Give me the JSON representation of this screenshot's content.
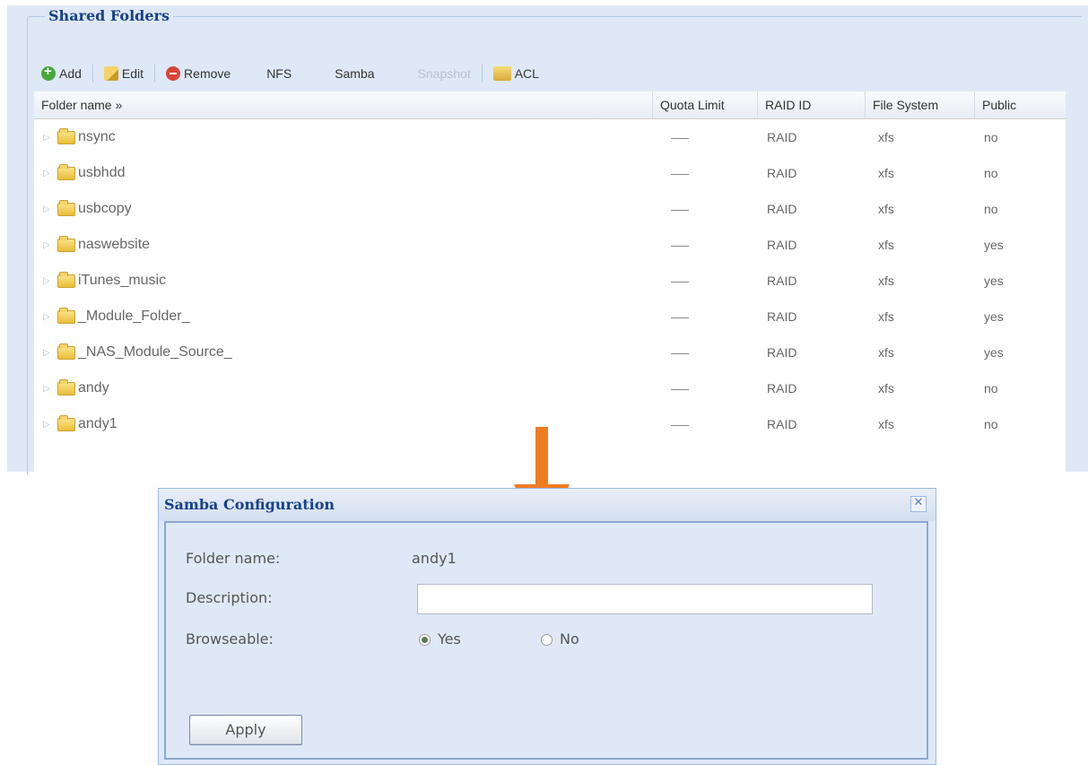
{
  "panel": {
    "title": "Shared Folders"
  },
  "toolbar": {
    "add": "Add",
    "edit": "Edit",
    "remove": "Remove",
    "nfs": "NFS",
    "samba": "Samba",
    "snapshot": "Snapshot",
    "acl": "ACL"
  },
  "grid": {
    "headers": {
      "name": "Folder name »",
      "quota": "Quota Limit",
      "raid": "RAID ID",
      "fs": "File System",
      "public": "Public"
    },
    "rows": [
      {
        "name": "nsync",
        "raid": "RAID",
        "fs": "xfs",
        "public": "no"
      },
      {
        "name": "usbhdd",
        "raid": "RAID",
        "fs": "xfs",
        "public": "no"
      },
      {
        "name": "usbcopy",
        "raid": "RAID",
        "fs": "xfs",
        "public": "no"
      },
      {
        "name": "naswebsite",
        "raid": "RAID",
        "fs": "xfs",
        "public": "yes"
      },
      {
        "name": "iTunes_music",
        "raid": "RAID",
        "fs": "xfs",
        "public": "yes"
      },
      {
        "name": "_Module_Folder_",
        "raid": "RAID",
        "fs": "xfs",
        "public": "yes"
      },
      {
        "name": "_NAS_Module_Source_",
        "raid": "RAID",
        "fs": "xfs",
        "public": "yes"
      },
      {
        "name": "andy",
        "raid": "RAID",
        "fs": "xfs",
        "public": "no"
      },
      {
        "name": "andy1",
        "raid": "RAID",
        "fs": "xfs",
        "public": "no"
      }
    ]
  },
  "dialog": {
    "title": "Samba Configuration",
    "folder_label": "Folder name:",
    "folder_value": "andy1",
    "description_label": "Description:",
    "description_value": "",
    "browseable_label": "Browseable:",
    "yes_label": "Yes",
    "no_label": "No",
    "browseable_selected": "Yes",
    "apply_label": "Apply"
  },
  "colors": {
    "panel_bg": "#dfe8f6",
    "title_blue": "#15428b",
    "arrow": "#f07c22"
  }
}
